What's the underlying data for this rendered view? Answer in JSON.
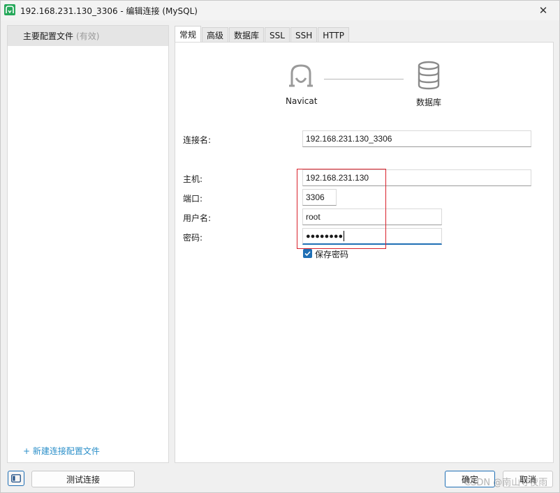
{
  "window": {
    "title": "192.168.231.130_3306 - 编辑连接 (MySQL)",
    "close_glyph": "✕"
  },
  "sidebar": {
    "profile_name": "主要配置文件",
    "profile_status": "(有效)",
    "new_profile_link": "+ 新建连接配置文件"
  },
  "tabs": [
    {
      "label": "常规",
      "active": true
    },
    {
      "label": "高级"
    },
    {
      "label": "数据库"
    },
    {
      "label": "SSL"
    },
    {
      "label": "SSH"
    },
    {
      "label": "HTTP"
    }
  ],
  "diagram": {
    "left_label": "Navicat",
    "right_label": "数据库",
    "left_icon": "navicat-logo-icon",
    "right_icon": "database-icon"
  },
  "form": {
    "connection_name_label": "连接名:",
    "connection_name_value": "192.168.231.130_3306",
    "host_label": "主机:",
    "host_value": "192.168.231.130",
    "port_label": "端口:",
    "port_value": "3306",
    "username_label": "用户名:",
    "username_value": "root",
    "password_label": "密码:",
    "password_value": "●●●●●●●●",
    "save_password_label": "保存密码",
    "save_password_checked": true
  },
  "footer": {
    "test_button": "测试连接",
    "ok_button": "确定",
    "cancel_button": "取消"
  },
  "watermark": "CSDN @南山寺夜雨",
  "colors": {
    "accent": "#1f6fb5",
    "highlight": "#d9202a",
    "link": "#2b8fc9",
    "app_icon": "#26a85a"
  }
}
